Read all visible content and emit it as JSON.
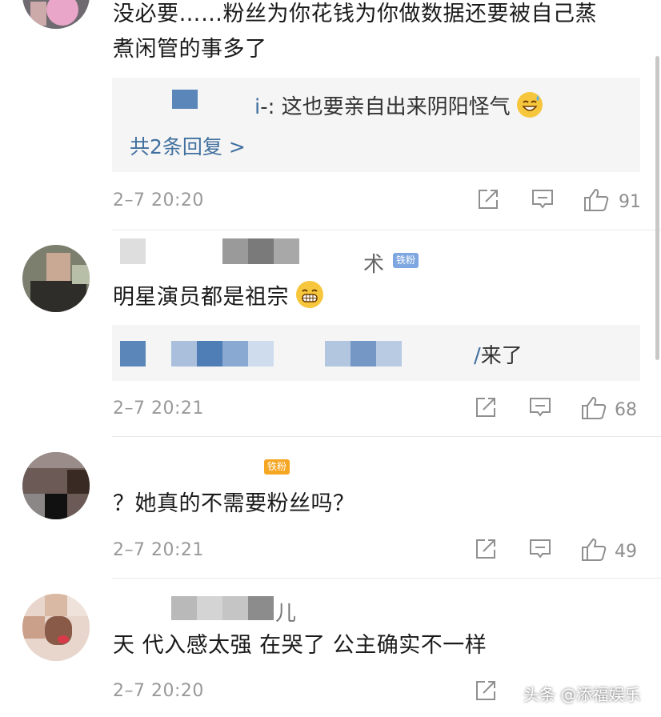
{
  "comments": [
    {
      "text_line1": "没必要……粉丝为你花钱为你做数据还要被自己蒸",
      "text_line2": "煮闲管的事多了",
      "reply_preview": "-: 这也要亲自出来阴阳怪气",
      "more_replies": "共2条回复 >",
      "time": "2–7 20:20",
      "likes": "91"
    },
    {
      "username_tail": "术",
      "badge": "铁粉",
      "text": "明星演员都是祖宗",
      "reply_preview": "来了",
      "time": "2–7 20:21",
      "likes": "68"
    },
    {
      "badge": "铁粉",
      "text": "？她真的不需要粉丝吗？",
      "time": "2–7 20:21",
      "likes": "49"
    },
    {
      "username_tail": "儿",
      "text": "天 代入感太强 在哭了 公主确实不一样",
      "time": "2–7 20:20"
    }
  ],
  "watermark": "头条 @添福娱乐",
  "colors": {
    "accent_blue": "#41709f",
    "badge_blue": "#7ea6e0",
    "badge_orange": "#f5a623"
  }
}
